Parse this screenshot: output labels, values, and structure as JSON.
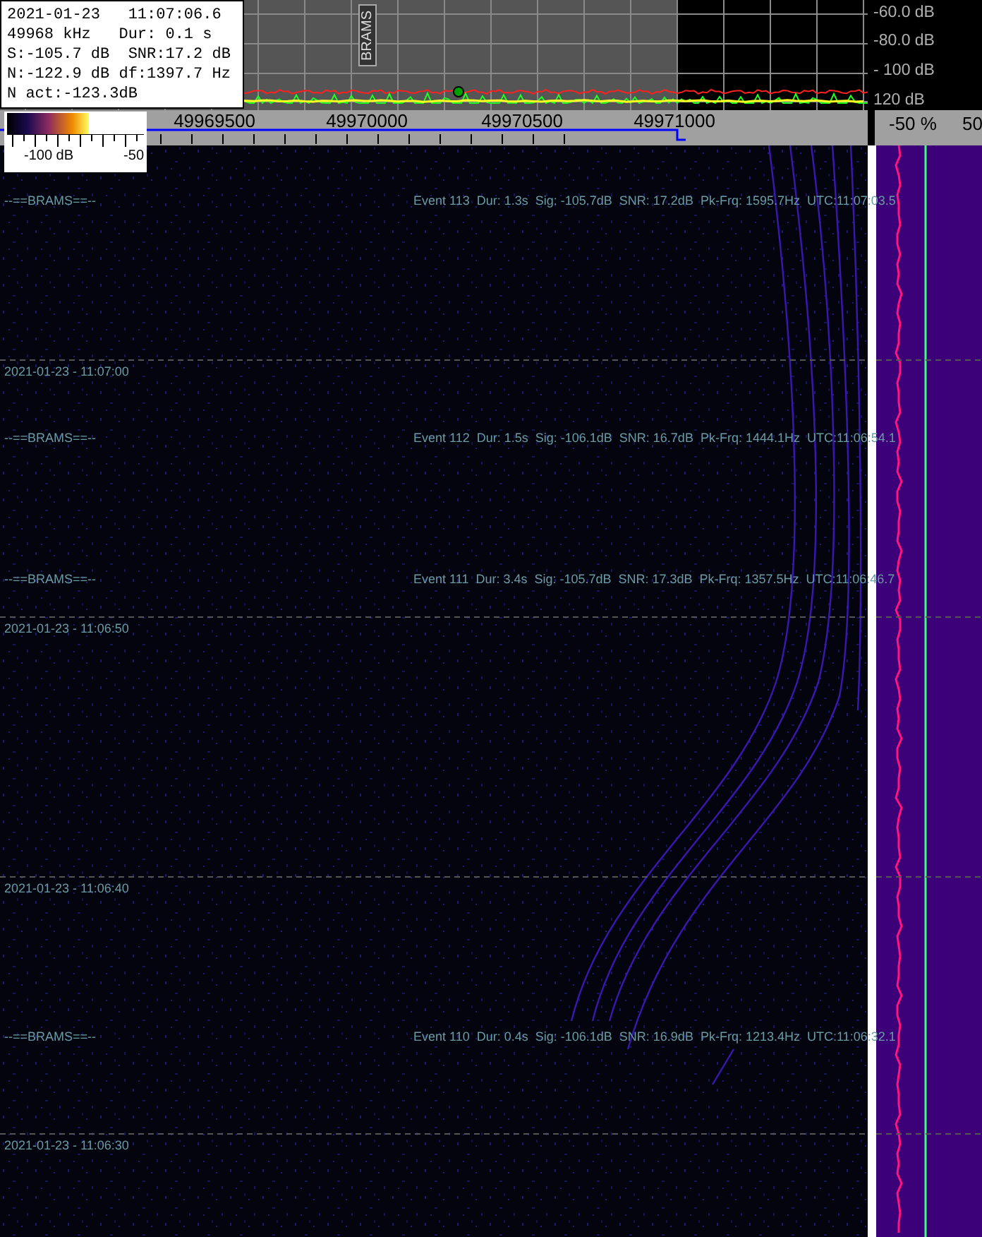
{
  "info_box": {
    "lines": [
      "2021-01-23   11:07:06.6",
      "49968 kHz   Dur: 0.1 s",
      "S:-105.7 dB  SNR:17.2 dB",
      "N:-122.9 dB df:1397.7 Hz",
      "N act:-123.3dB"
    ]
  },
  "spectrum": {
    "label": "BRAMS",
    "db_labels": [
      "-60.0 dB",
      "-80.0 dB",
      "- 100 dB",
      "120 dB"
    ]
  },
  "frequency_axis": {
    "labels": [
      "49969500",
      "49970000",
      "49970500",
      "49971000"
    ]
  },
  "color_scale": {
    "labels": [
      "-100 dB",
      "-50"
    ]
  },
  "level_axis": {
    "labels": [
      "-50 %",
      "50"
    ]
  },
  "waterfall": {
    "events": [
      {
        "banner": "--==BRAMS==--",
        "text": "Event 113  Dur: 1.3s  Sig: -105.7dB  SNR: 17.2dB  Pk-Frq: 1595.7Hz  UTC:11:07:03.5"
      },
      {
        "banner": "--==BRAMS==--",
        "text": "Event 112  Dur: 1.5s  Sig: -106.1dB  SNR: 16.7dB  Pk-Frq: 1444.1Hz  UTC:11:06:54.1"
      },
      {
        "banner": "--==BRAMS==--",
        "text": "Event 111  Dur: 3.4s  Sig: -105.7dB  SNR: 17.3dB  Pk-Frq: 1357.5Hz  UTC:11:06:46.7"
      },
      {
        "banner": "--==BRAMS==--",
        "text": "Event 110  Dur: 0.4s  Sig: -106.1dB  SNR: 16.9dB  Pk-Frq: 1213.4Hz  UTC:11:06:32.1"
      }
    ],
    "timestamps": [
      "2021-01-23 - 11:07:00",
      "2021-01-23 - 11:06:50",
      "2021-01-23 - 11:06:40",
      "2021-01-23 - 11:06:30"
    ]
  }
}
